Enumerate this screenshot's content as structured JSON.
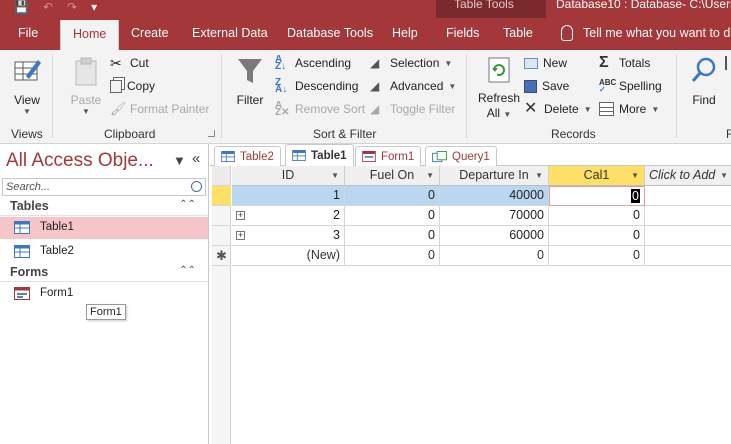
{
  "titlebar": {
    "context_group": "Table Tools",
    "window_title": "Database10 : Database- C:\\Users\\"
  },
  "ribbon_tabs": [
    "File",
    "Home",
    "Create",
    "External Data",
    "Database Tools",
    "Help",
    "Fields",
    "Table"
  ],
  "tell_me": "Tell me what you want to d",
  "groups": {
    "views": "Views",
    "clipboard": "Clipboard",
    "sort_filter": "Sort & Filter",
    "records": "Records",
    "find": "F"
  },
  "buttons": {
    "view": "View",
    "paste": "Paste",
    "cut": "Cut",
    "copy": "Copy",
    "format_painter": "Format Painter",
    "filter": "Filter",
    "ascending": "Ascending",
    "descending": "Descending",
    "remove_sort": "Remove Sort",
    "selection": "Selection",
    "advanced": "Advanced",
    "toggle_filter": "Toggle Filter",
    "refresh_all_1": "Refresh",
    "refresh_all_2": "All",
    "new": "New",
    "save": "Save",
    "delete": "Delete",
    "totals": "Totals",
    "spelling": "Spelling",
    "more": "More",
    "find": "Find"
  },
  "nav": {
    "title": "All Access Obje...",
    "search_placeholder": "Search...",
    "tables_header": "Tables",
    "forms_header": "Forms",
    "tables": [
      "Table1",
      "Table2"
    ],
    "forms": [
      "Form1"
    ],
    "tooltip": "Form1"
  },
  "doc_tabs": [
    "Table2",
    "Table1",
    "Form1",
    "Query1"
  ],
  "datasheet": {
    "columns": [
      "ID",
      "Fuel On",
      "Departure In",
      "Cal1",
      "Click to Add"
    ],
    "rows": [
      [
        "1",
        "0",
        "40000",
        "0"
      ],
      [
        "2",
        "0",
        "70000",
        "0"
      ],
      [
        "3",
        "0",
        "60000",
        "0"
      ]
    ],
    "new_row": [
      "(New)",
      "0",
      "0",
      "0"
    ]
  },
  "colors": {
    "accent": "#a4373a",
    "selection_yellow": "#ffe066",
    "row_highlight": "#b9d7f1"
  }
}
